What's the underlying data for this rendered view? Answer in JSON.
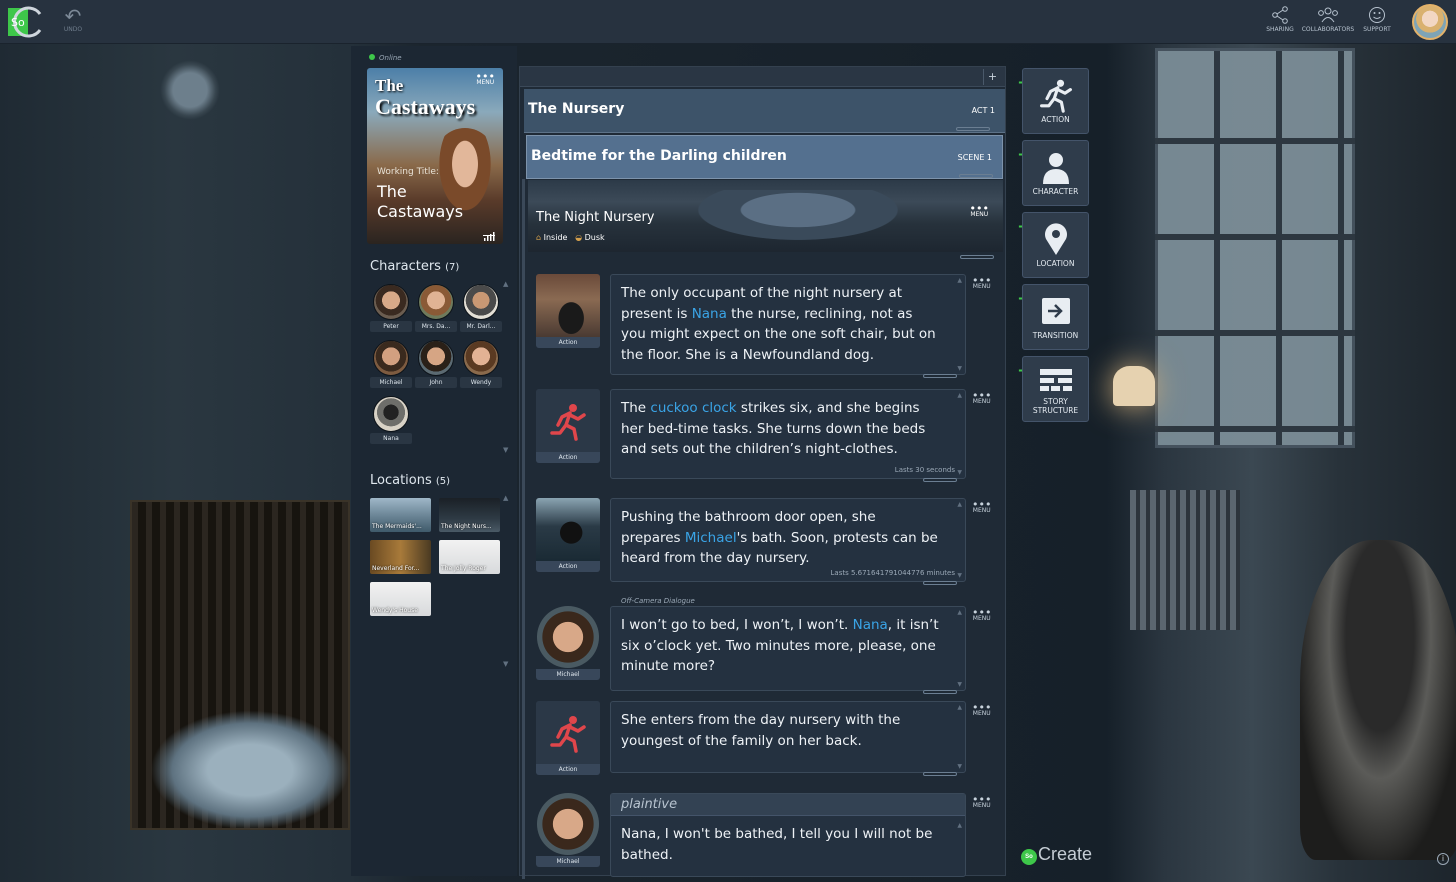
{
  "topbar": {
    "undo_label": "UNDO",
    "sharing_label": "SHARING",
    "collaborators_label": "COLLABORATORS",
    "support_label": "SUPPORT",
    "logo_text": "So"
  },
  "project": {
    "status": "Online",
    "cover_title_1": "The",
    "cover_title_2": "Castaways",
    "working_title_label": "Working Title:",
    "working_title": "The Castaways",
    "menu_label": "MENU"
  },
  "characters": {
    "heading": "Characters",
    "count": "(7)",
    "items": [
      "Peter",
      "Mrs. Da...",
      "Mr. Darl...",
      "Michael",
      "John",
      "Wendy",
      "Nana"
    ]
  },
  "locations": {
    "heading": "Locations",
    "count": "(5)",
    "items": [
      "The Mermaids'...",
      "The Night Nurs...",
      "Neverland For...",
      "The Jolly Roger",
      "Wendy's House"
    ]
  },
  "story": {
    "add_symbol": "+",
    "act": {
      "title": "The Nursery",
      "tag": "ACT 1"
    },
    "scene": {
      "title": "Bedtime for the Darling children",
      "tag": "SCENE 1"
    },
    "location_card": {
      "title": "The Night Nursery",
      "setting": "Inside",
      "time": "Dusk",
      "menu_label": "MENU"
    }
  },
  "elements": [
    {
      "type_label": "Action",
      "menu_label": "MENU",
      "text_1": "The only occupant of the night nursery at present is ",
      "link": "Nana",
      "text_2": " the nurse, reclining, not as you might expect on the one soft chair, but on the floor. She is a Newfoundland dog."
    },
    {
      "type_label": "Action",
      "menu_label": "MENU",
      "text_1": "The ",
      "link": "cuckoo clock",
      "text_2": " strikes six, and she begins her bed-time tasks. She turns down the beds and sets out the children’s night-clothes.",
      "duration": "Lasts 30 seconds"
    },
    {
      "type_label": "Action",
      "menu_label": "MENU",
      "text_1": "Pushing the bathroom door open, she prepares ",
      "link": "Michael",
      "text_2": "'s bath. Soon, protests can be heard from the day nursery.",
      "duration": "Lasts 5.671641791044776 minutes"
    },
    {
      "type_label": "Michael",
      "menu_label": "MENU",
      "note": "Off-Camera Dialogue",
      "text_1": "I won’t go to bed, I won’t, I won’t. ",
      "link": "Nana",
      "text_2": ", it isn’t six o’clock yet. Two minutes more, please, one minute more?"
    },
    {
      "type_label": "Action",
      "menu_label": "MENU",
      "text_1": "She enters from the day nursery with the youngest of the family on her back.",
      "link": "",
      "text_2": ""
    },
    {
      "type_label": "Michael",
      "menu_label": "MENU",
      "parenthetical": "plaintive",
      "text_1": "Nana, I won't be bathed, I tell you I will not be bathed.",
      "link": "",
      "text_2": ""
    }
  ],
  "tools": [
    {
      "label": "ACTION",
      "icon": "action-icon"
    },
    {
      "label": "CHARACTER",
      "icon": "character-icon"
    },
    {
      "label": "LOCATION",
      "icon": "location-icon"
    },
    {
      "label": "TRANSITION",
      "icon": "transition-icon"
    },
    {
      "label_1": "STORY",
      "label_2": "STRUCTURE",
      "icon": "story-structure-icon"
    }
  ],
  "brand": {
    "badge": "So",
    "text": "Create"
  },
  "info_symbol": "i"
}
